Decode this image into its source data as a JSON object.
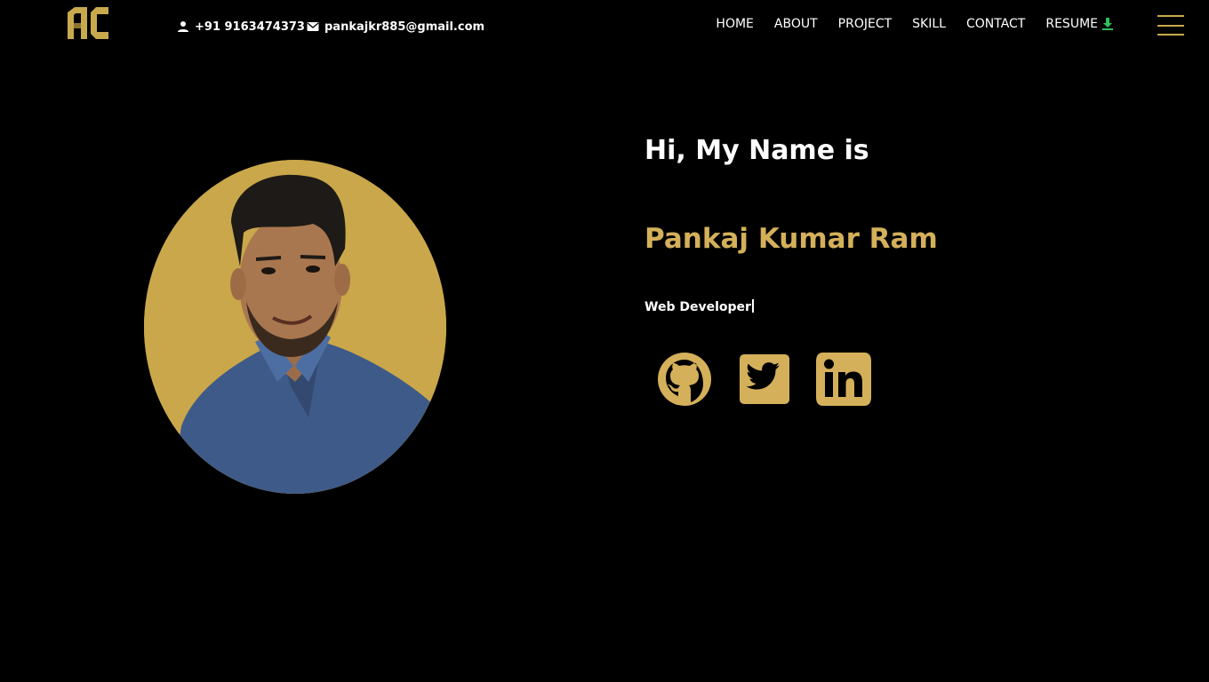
{
  "header": {
    "logo_text": "AC",
    "phone": "+91 9163474373",
    "email": "pankajkr885@gmail.com",
    "nav": [
      {
        "label": "HOME"
      },
      {
        "label": "ABOUT"
      },
      {
        "label": "PROJECT"
      },
      {
        "label": "SKILL"
      },
      {
        "label": "CONTACT"
      },
      {
        "label": "RESUME"
      }
    ]
  },
  "hero": {
    "greeting": "Hi, My Name is",
    "name": "Pankaj Kumar Ram",
    "role": "Web Developer"
  },
  "social": [
    "github-icon",
    "twitter-icon",
    "linkedin-icon"
  ],
  "colors": {
    "background": "#000000",
    "accent_gold": "#d4b05a",
    "download_green": "#2fbf5f",
    "text": "#ffffff"
  }
}
